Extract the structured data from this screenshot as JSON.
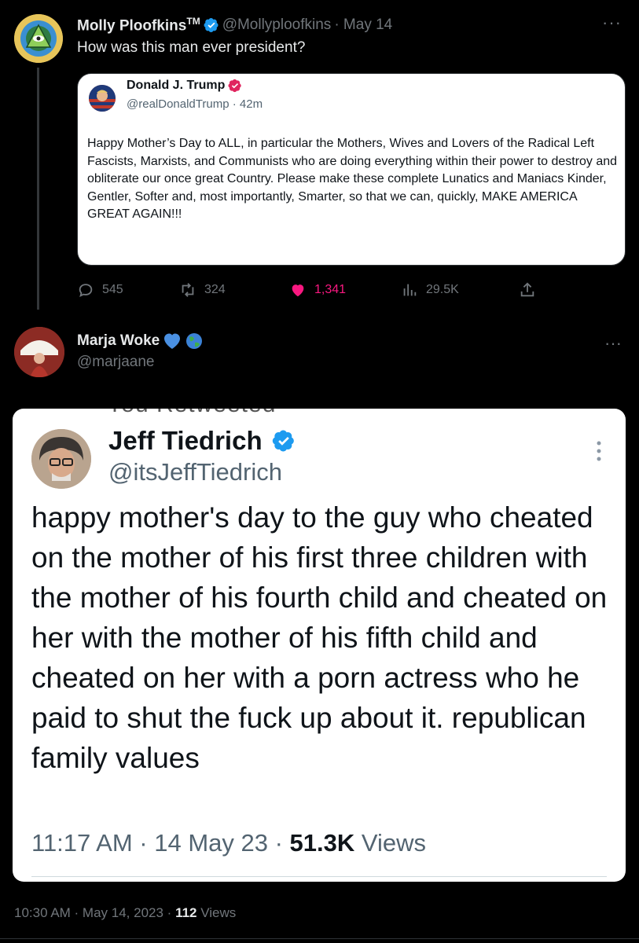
{
  "main_tweet": {
    "author": {
      "name": "Molly Ploofkins",
      "tm": "TM",
      "handle": "@Mollyploofkins",
      "date": "· May 14"
    },
    "more": "···",
    "text": "How was this man ever president?",
    "quote": {
      "name": "Donald J. Trump",
      "handle": "@realDonaldTrump · 42m",
      "text": "Happy Mother’s Day to ALL, in particular the Mothers, Wives and Lovers of the Radical Left Fascists, Marxists, and Communists who are doing everything within their power to destroy and obliterate our once great Country. Please make these complete Lunatics and Maniacs Kinder, Gentler, Softer and, most importantly, Smarter, so that we can, quickly, MAKE AMERICA GREAT AGAIN!!!"
    },
    "actions": {
      "replies": "545",
      "retweets": "324",
      "likes": "1,341",
      "views": "29.5K"
    }
  },
  "reply_tweet": {
    "author": {
      "name": "Marja Woke",
      "handle": "@marjaane"
    },
    "more": "···",
    "embedded_screenshot": {
      "clipped_text": "You Retweeted",
      "name": "Jeff Tiedrich",
      "handle": "@itsJeffTiedrich",
      "more": "⋮",
      "text": "happy mother's day to the guy who cheated on the mother of his first three children with the mother of his fourth child and cheated on her with the mother of his fifth child and cheated on her with a porn actress who he paid to shut the fuck up about it. republican family values",
      "time": "11:17 AM · 14 May 23 · ",
      "views_count": "51.3K",
      "views_label": " Views"
    },
    "footer": {
      "timestamp": "10:30 AM · May 14, 2023 · ",
      "views_count": "112",
      "views_label": " Views"
    }
  },
  "colors": {
    "background": "#000000",
    "verified_blue": "#1d9bf0",
    "like_pink": "#f91880",
    "muted": "#71767b",
    "trump_badge": "#e0245e"
  }
}
